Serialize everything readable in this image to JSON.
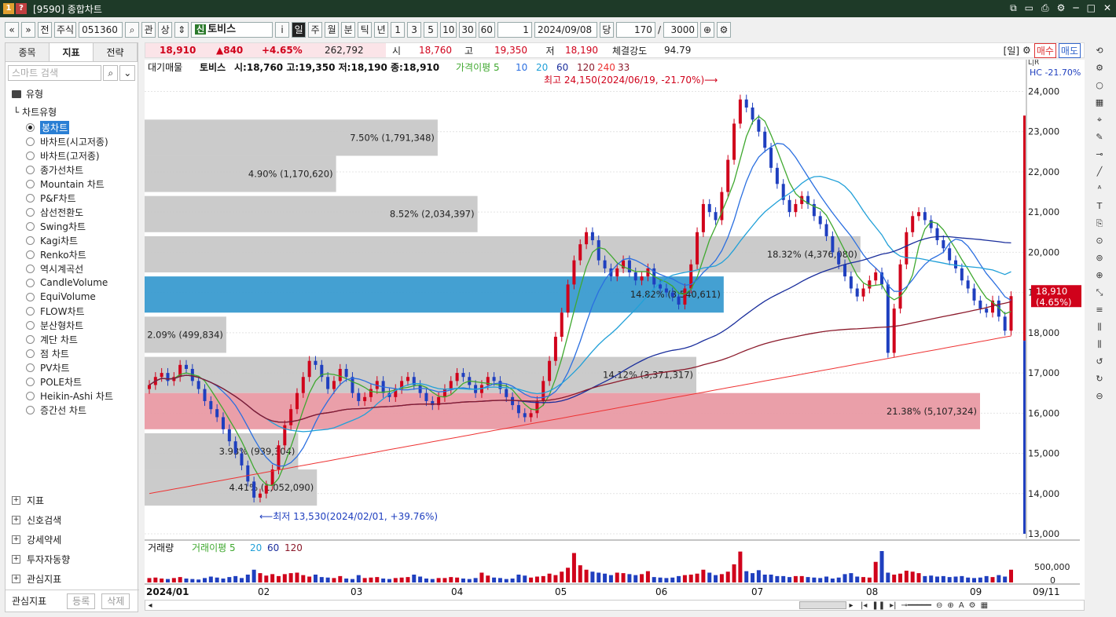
{
  "window": {
    "icon1": "1",
    "icon2": "?",
    "title": "[9590] 종합차트"
  },
  "toolbar": {
    "prev": "«",
    "next": "»",
    "jeon": "전",
    "market": "주식",
    "code": "051360",
    "gwan": "관",
    "sang": "상",
    "sin": "신",
    "name": "토비스",
    "info": "i",
    "periods": [
      "일",
      "주",
      "월",
      "분",
      "틱",
      "년"
    ],
    "nums": [
      "1",
      "3",
      "5",
      "10",
      "30",
      "60"
    ],
    "interval": "1",
    "date": "2024/09/08",
    "dang": "당",
    "count": "170",
    "slash": "/",
    "total": "3000"
  },
  "left": {
    "tabs": [
      "종목",
      "지표",
      "전략"
    ],
    "search_placeholder": "스마트 검색",
    "section": "유형",
    "chart_type_title": "차트유형",
    "chart_types": [
      "봉차트",
      "바차트(시고저종)",
      "바차트(고저종)",
      "종가선차트",
      "Mountain 차트",
      "P&F차트",
      "삼선전환도",
      "Swing차트",
      "Kagi차트",
      "Renko차트",
      "역시계곡선",
      "CandleVolume",
      "EquiVolume",
      "FLOW차트",
      "분산형차트",
      "계단 차트",
      "점 차트",
      "PV차트",
      "POLE차트",
      "Heikin-Ashi 차트",
      "증간선 차트"
    ],
    "bottom": [
      "지표",
      "신호검색",
      "강세약세",
      "투자자동향",
      "관심지표"
    ],
    "fav": "관심지표",
    "reg": "등록",
    "del": "삭제"
  },
  "infobar": {
    "price": "18,910",
    "change": "▲840",
    "pct": "+4.65%",
    "volume": "262,792",
    "open_l": "시",
    "open": "18,760",
    "high_l": "고",
    "high": "19,350",
    "low_l": "저",
    "low": "18,190",
    "strength_l": "체결강도",
    "strength": "94.79",
    "period": "[일]",
    "buy": "매수",
    "sell": "매도"
  },
  "chart": {
    "legend_vp": "대기매물",
    "legend_name": "토비스",
    "legend_ohlc": "시:18,760 고:19,350 저:18,190 종:18,910",
    "legend_ma": "가격이평 5",
    "ma_nums": [
      "10",
      "20",
      "60",
      "120",
      "240",
      "33"
    ],
    "max_note": "최고 24,150(2024/06/19, -21.70%)⟶",
    "min_note": "⟵최저 13,530(2024/02/01, +39.76%)",
    "hc": "HC -21.70%",
    "lr": "L|R",
    "cur_price": "18,910",
    "cur_pct": "(4.65%)",
    "vp_labels": [
      "7.50% (1,791,348)",
      "4.90% (1,170,620)",
      "8.52% (2,034,397)",
      "18.32% (4,376,080)",
      "14.82% (3,540,611)",
      "2.09% (499,834)",
      "14.12% (3,371,317)",
      "21.38% (5,107,324)",
      "3.93% (939,304)",
      "4.41% (1,052,090)"
    ],
    "y_ticks": [
      "24,000",
      "23,000",
      "22,000",
      "21,000",
      "20,000",
      "19,000",
      "18,000",
      "17,000",
      "16,000",
      "15,000",
      "14,000",
      "13,000"
    ],
    "x_labels": [
      "2024/01",
      "02",
      "03",
      "04",
      "05",
      "06",
      "07",
      "08",
      "09",
      "09/11"
    ],
    "vol_legend": "거래량",
    "vol_ma": "거래이평 5",
    "vol_nums": [
      "20",
      "60",
      "120"
    ],
    "vol_ticks": [
      "500,000",
      "0"
    ]
  },
  "chart_data": {
    "type": "candlestick",
    "symbol": "토비스",
    "ylim": [
      13000,
      24400
    ],
    "last": {
      "open": 18760,
      "high": 19350,
      "low": 18190,
      "close": 18910
    },
    "high_point": {
      "value": 24150,
      "date": "2024/06/19"
    },
    "low_point": {
      "value": 13530,
      "date": "2024/02/01"
    },
    "volume_profile": [
      {
        "low": 22400,
        "high": 23300,
        "pct": 7.5,
        "vol": 1791348
      },
      {
        "low": 21500,
        "high": 22400,
        "pct": 4.9,
        "vol": 1170620
      },
      {
        "low": 20500,
        "high": 21400,
        "pct": 8.52,
        "vol": 2034397
      },
      {
        "low": 19500,
        "high": 20400,
        "pct": 18.32,
        "vol": 4376080
      },
      {
        "low": 18500,
        "high": 19400,
        "pct": 14.82,
        "vol": 3540611
      },
      {
        "low": 17500,
        "high": 18400,
        "pct": 2.09,
        "vol": 499834
      },
      {
        "low": 16500,
        "high": 17400,
        "pct": 14.12,
        "vol": 3371317
      },
      {
        "low": 15600,
        "high": 16500,
        "pct": 21.38,
        "vol": 5107324
      },
      {
        "low": 14600,
        "high": 15500,
        "pct": 3.93,
        "vol": 939304
      },
      {
        "low": 13700,
        "high": 14600,
        "pct": 4.41,
        "vol": 1052090
      }
    ],
    "closes": [
      16700,
      16900,
      17000,
      16800,
      16900,
      17200,
      17100,
      16800,
      16600,
      16300,
      16100,
      15900,
      15600,
      15300,
      15000,
      14700,
      14300,
      13900,
      14000,
      14200,
      14600,
      15200,
      15700,
      16100,
      16500,
      16900,
      17300,
      17200,
      16900,
      16600,
      16800,
      17100,
      16900,
      16500,
      16300,
      16400,
      16600,
      16800,
      16500,
      16400,
      16600,
      16800,
      16900,
      16700,
      16500,
      16300,
      16200,
      16400,
      16600,
      16800,
      17000,
      16900,
      16700,
      16500,
      16700,
      16900,
      16800,
      16600,
      16400,
      16200,
      16000,
      15900,
      16000,
      16300,
      16800,
      17300,
      17900,
      18500,
      19200,
      19800,
      20200,
      20500,
      20300,
      19800,
      19600,
      19400,
      19600,
      19800,
      19500,
      19300,
      19400,
      19600,
      19200,
      19100,
      19000,
      18900,
      18700,
      19100,
      19700,
      20500,
      21200,
      21000,
      20800,
      21500,
      22300,
      23200,
      23800,
      23600,
      23300,
      23000,
      22600,
      22100,
      21700,
      21300,
      21000,
      21200,
      21400,
      21200,
      20900,
      20700,
      20400,
      20000,
      19700,
      19400,
      19100,
      18900,
      19100,
      19300,
      19500,
      19200,
      17500,
      18600,
      19700,
      20500,
      20900,
      21000,
      20800,
      20600,
      20300,
      20100,
      19800,
      19600,
      19300,
      19100,
      18800,
      18600,
      18500,
      18800,
      18400,
      18050,
      18910
    ],
    "volumes": [
      90,
      100,
      80,
      70,
      90,
      110,
      80,
      70,
      60,
      90,
      120,
      100,
      80,
      110,
      130,
      90,
      160,
      260,
      190,
      140,
      170,
      130,
      170,
      190,
      200,
      150,
      120,
      160,
      110,
      100,
      90,
      130,
      80,
      70,
      150,
      90,
      100,
      110,
      80,
      70,
      90,
      100,
      110,
      160,
      120,
      80,
      70,
      90,
      90,
      110,
      100,
      80,
      70,
      90,
      200,
      140,
      100,
      90,
      70,
      80,
      160,
      140,
      100,
      120,
      130,
      180,
      150,
      220,
      300,
      600,
      350,
      260,
      220,
      200,
      180,
      150,
      200,
      190,
      170,
      150,
      170,
      230,
      110,
      100,
      90,
      100,
      130,
      150,
      160,
      180,
      260,
      200,
      150,
      170,
      220,
      370,
      630,
      230,
      190,
      250,
      160,
      160,
      130,
      130,
      110,
      130,
      130,
      110,
      100,
      90,
      120,
      80,
      100,
      170,
      190,
      120,
      110,
      100,
      420,
      640,
      200,
      160,
      180,
      240,
      220,
      190,
      130,
      140,
      120,
      130,
      110,
      120,
      130,
      100,
      90,
      100,
      130,
      110,
      150,
      120,
      260
    ]
  },
  "tools": [
    "⟲",
    "⚙",
    "○",
    "▦",
    "⌖",
    "✎",
    "⊸",
    "╱",
    "ᴬ",
    "T",
    "⎘",
    "⊙",
    "⊚",
    "⊕",
    "⤡",
    "≡",
    "⫼",
    "⫼",
    "↺",
    "↻",
    "⊖"
  ]
}
